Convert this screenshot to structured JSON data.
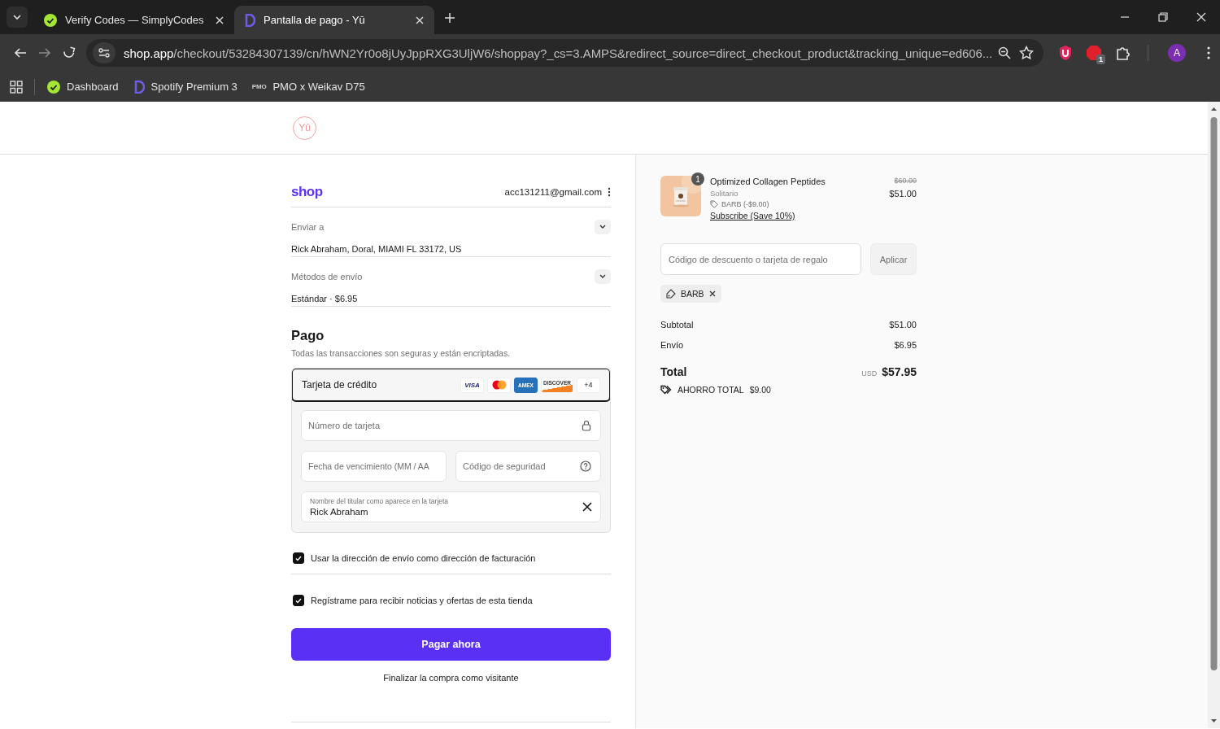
{
  "browser": {
    "tabs": [
      {
        "title": "Verify Codes — SimplyCodes",
        "kind": "check",
        "selected": false
      },
      {
        "title": "Pantalla de pago - Yū",
        "kind": "shop",
        "selected": true
      }
    ],
    "url_host": "shop.app",
    "url_path": "/checkout/53284307139/cn/hWN2Yr0o8jUyJppRXG3UljW6/shoppay?_cs=3.AMPS&redirect_source=direct_checkout_product&tracking_unique=ed606...",
    "extensions": [
      {
        "kind": "shield"
      },
      {
        "kind": "stop",
        "badge": "1"
      },
      {
        "kind": "puzzle"
      }
    ],
    "profile_initial": "A",
    "bookmarks": [
      {
        "label": "Dashboard",
        "kind": "check"
      },
      {
        "label": "Spotify Premium 3",
        "kind": "shop"
      },
      {
        "label": "PMO x Weikav D75",
        "kind": "text",
        "icon_text": "PMO"
      }
    ]
  },
  "store": {
    "logo": "Yū"
  },
  "account": {
    "brand": "shop",
    "email": "acc131211@gmail.com"
  },
  "sections": [
    {
      "label": "Enviar a",
      "value": "Rick Abraham, Doral, MIAMI FL 33172, US",
      "expanded": false
    },
    {
      "label": "Métodos de envío",
      "value": "Estándar · $6.95",
      "expanded": false
    }
  ],
  "payment": {
    "title": "Pago",
    "subtitle": "Todas las transacciones son seguras y están encriptadas.",
    "method": {
      "label": "Tarjeta de crédito",
      "selected": true
    },
    "brands": [
      {
        "kind": "visa",
        "text": "VISA"
      },
      {
        "kind": "mastercard"
      },
      {
        "kind": "amex",
        "text": "AMEX"
      },
      {
        "kind": "discover",
        "text": "DISCOVER"
      },
      {
        "kind": "more",
        "text": "+4"
      }
    ],
    "fields": [
      {
        "kind": "number",
        "placeholder": "Número de tarjeta"
      },
      {
        "kind": "expiry",
        "placeholder": "Fecha de vencimiento (MM / AA"
      },
      {
        "kind": "cvv",
        "placeholder": "Código de seguridad"
      },
      {
        "kind": "name",
        "label": "Nombre del titular como aparece en la tarjeta",
        "value": "Rick Abraham"
      }
    ]
  },
  "checkboxes": [
    {
      "label": "Usar la dirección de envío como dirección de facturación",
      "checked": true
    },
    {
      "label": "Regístrame para recibir noticias y ofertas de esta tienda",
      "checked": true
    }
  ],
  "pay_button": "Pagar ahora",
  "guest_link": "Finalizar la compra como visitante",
  "summary": {
    "item": {
      "quantity": "1",
      "name": "Optimized Collagen Peptides",
      "variant": "Solitario",
      "discount": "BARB (-$9.00)",
      "subscribe": "Subscribe (Save 10%)",
      "original_price": "$60.00",
      "price": "$51.00"
    },
    "discount_field": {
      "placeholder": "Código de descuento o tarjeta de regalo"
    },
    "apply_button": "Aplicar",
    "codes": [
      "BARB"
    ],
    "lines": [
      {
        "label": "Subtotal",
        "value": "$51.00"
      },
      {
        "label": "Envío",
        "value": "$6.95"
      }
    ],
    "total": {
      "label": "Total",
      "currency": "USD",
      "value": "$57.95"
    },
    "savings": {
      "label": "AHORRO TOTAL",
      "value": "$9.00"
    }
  }
}
